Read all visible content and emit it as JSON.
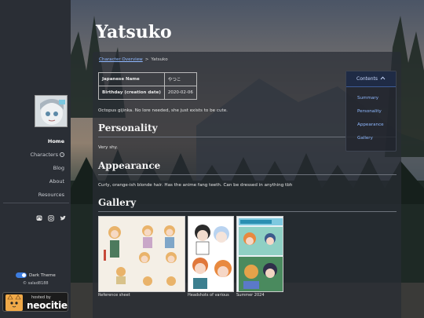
{
  "page": {
    "title": "Yatsuko"
  },
  "sidebar": {
    "nav": [
      {
        "label": "Home",
        "active": true
      },
      {
        "label": "Characters",
        "active": false
      },
      {
        "label": "Blog",
        "active": false
      },
      {
        "label": "About",
        "active": false
      },
      {
        "label": "Resources",
        "active": false
      }
    ],
    "social_icons": [
      "mastodon-icon",
      "instagram-icon",
      "twitter-icon"
    ],
    "theme_toggle": {
      "label": "Dark Theme",
      "enabled": true
    },
    "copyright": "© salad8188",
    "badge": {
      "small_text": "hosted by",
      "big_text": "neocities"
    }
  },
  "breadcrumb": {
    "link": "Character Overview",
    "separator": ">",
    "current": "Yatsuko"
  },
  "info_table": [
    {
      "key": "Japanese Name",
      "value": "やつこ"
    },
    {
      "key": "Birthday (creation date)",
      "value": "2020-02-06"
    }
  ],
  "intro": "Octopus gijinka. No lore needed, she just exists to be cute.",
  "sections": {
    "personality": {
      "heading": "Personality",
      "text": "Very shy."
    },
    "appearance": {
      "heading": "Appearance",
      "text": "Curly, orange-ish blonde hair. Has the anime fang teeth. Can be dressed in anything tbh"
    },
    "gallery": {
      "heading": "Gallery"
    }
  },
  "gallery": [
    {
      "caption": "Reference sheet"
    },
    {
      "caption": "Headshots of various"
    },
    {
      "caption": "Summer 2024"
    }
  ],
  "contents": {
    "button_label": "Contents",
    "items": [
      "Summary",
      "Personality",
      "Appearance",
      "Gallery"
    ]
  },
  "colors": {
    "accent": "#3d7de0",
    "link": "#8fb8ff",
    "sidebar_bg": "#2a2e35"
  }
}
